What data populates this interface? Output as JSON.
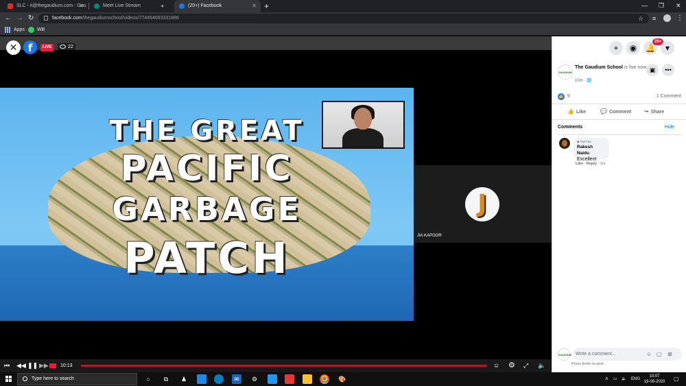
{
  "browser": {
    "tabs": [
      {
        "title": "SLC - it@thegaudium.com - Gau",
        "favicon_color": "#d93025"
      },
      {
        "title": "Meet Live Stream",
        "favicon_color": "#00897b"
      },
      {
        "title": "(20+) Facebook",
        "favicon_color": "#1877f2"
      }
    ],
    "url_host": "facebook.com",
    "url_path": "/thegaudiumschool/videos/774494693331886",
    "bookmarks": [
      {
        "label": "Apps"
      },
      {
        "label": "WB"
      }
    ]
  },
  "video": {
    "live_label": "LIVE",
    "viewer_count": "22",
    "slide_lines": [
      "THE GREAT",
      "PACIFIC",
      "GARBAGE",
      "PATCH"
    ],
    "participant_initial": "J",
    "participant_name": "JIA KAPOOR",
    "current_time": "10:13",
    "progress_played": 0.0
  },
  "panel": {
    "notification_badge": "20+",
    "page_logo_text": "GAUDIUM",
    "page_name": "The Gaudium School",
    "status_text": "is live now.",
    "post_time": "10m · 🌐",
    "like_count": "9",
    "comment_count": "1 Comment",
    "actions": {
      "like": "Like",
      "comment": "Comment",
      "share": "Share"
    },
    "comments_header": "Comments",
    "hide_label": "Hide",
    "comment": {
      "badge": "Top Fan",
      "author": "Rakesh Naidu",
      "text": "Excellent",
      "meta_like": "Like",
      "meta_reply": "Reply",
      "meta_time": "1m"
    },
    "comment_placeholder": "Write a comment...",
    "enter_hint": "Press Enter to post."
  },
  "taskbar": {
    "search_placeholder": "Type here to search",
    "language": "ENG",
    "time": "10:07",
    "date": "19-09-2020"
  },
  "colors": {
    "facebook_blue": "#1877f2",
    "live_red": "#e41e3f"
  }
}
